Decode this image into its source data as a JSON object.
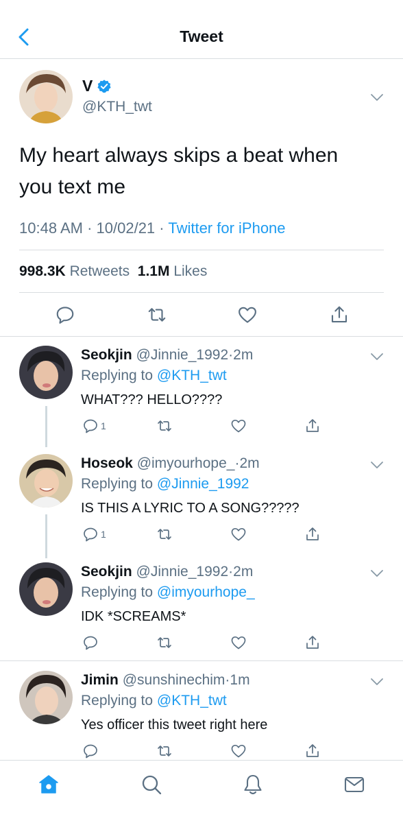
{
  "header": {
    "title": "Tweet"
  },
  "main_tweet": {
    "name": "V",
    "handle": "@KTH_twt",
    "text": "My heart always skips a beat when you text me",
    "time": "10:48 AM",
    "date": "10/02/21",
    "source": "Twitter for iPhone",
    "separator": "·",
    "retweets_count": "998.3K",
    "retweets_label": "Retweets",
    "likes_count": "1.1M",
    "likes_label": "Likes"
  },
  "replies": [
    {
      "name": "Seokjin",
      "handle": "@Jinnie_1992",
      "separator": "·",
      "time": "2m",
      "replying_prefix": "Replying to",
      "replying_to": "@KTH_twt",
      "text": "WHAT??? HELLO????",
      "reply_count": "1"
    },
    {
      "name": "Hoseok",
      "handle": "@imyourhope_",
      "separator": "·",
      "time": "2m",
      "replying_prefix": "Replying to",
      "replying_to": "@Jinnie_1992",
      "text": "IS THIS A LYRIC TO A SONG?????",
      "reply_count": "1"
    },
    {
      "name": "Seokjin",
      "handle": "@Jinnie_1992",
      "separator": "·",
      "time": "2m",
      "replying_prefix": "Replying to",
      "replying_to": "@imyourhope_",
      "text": "IDK *SCREAMS*",
      "reply_count": ""
    },
    {
      "name": "Jimin",
      "handle": "@sunshinechim",
      "separator": "·",
      "time": "1m",
      "replying_prefix": "Replying to",
      "replying_to": "@KTH_twt",
      "text": "Yes officer this tweet right here",
      "reply_count": ""
    }
  ],
  "icons": {
    "back": "chevron-left-icon",
    "verified": "verified-badge-icon",
    "more": "chevron-down-icon",
    "reply": "reply-icon",
    "retweet": "retweet-icon",
    "like": "heart-icon",
    "share": "share-icon",
    "home": "home-icon",
    "search": "search-icon",
    "notifications": "bell-icon",
    "messages": "mail-icon"
  },
  "colors": {
    "accent": "#1d9bf0",
    "secondary_text": "#5b7083",
    "divider": "#d9dde0",
    "thread_line": "#cfd9de"
  }
}
